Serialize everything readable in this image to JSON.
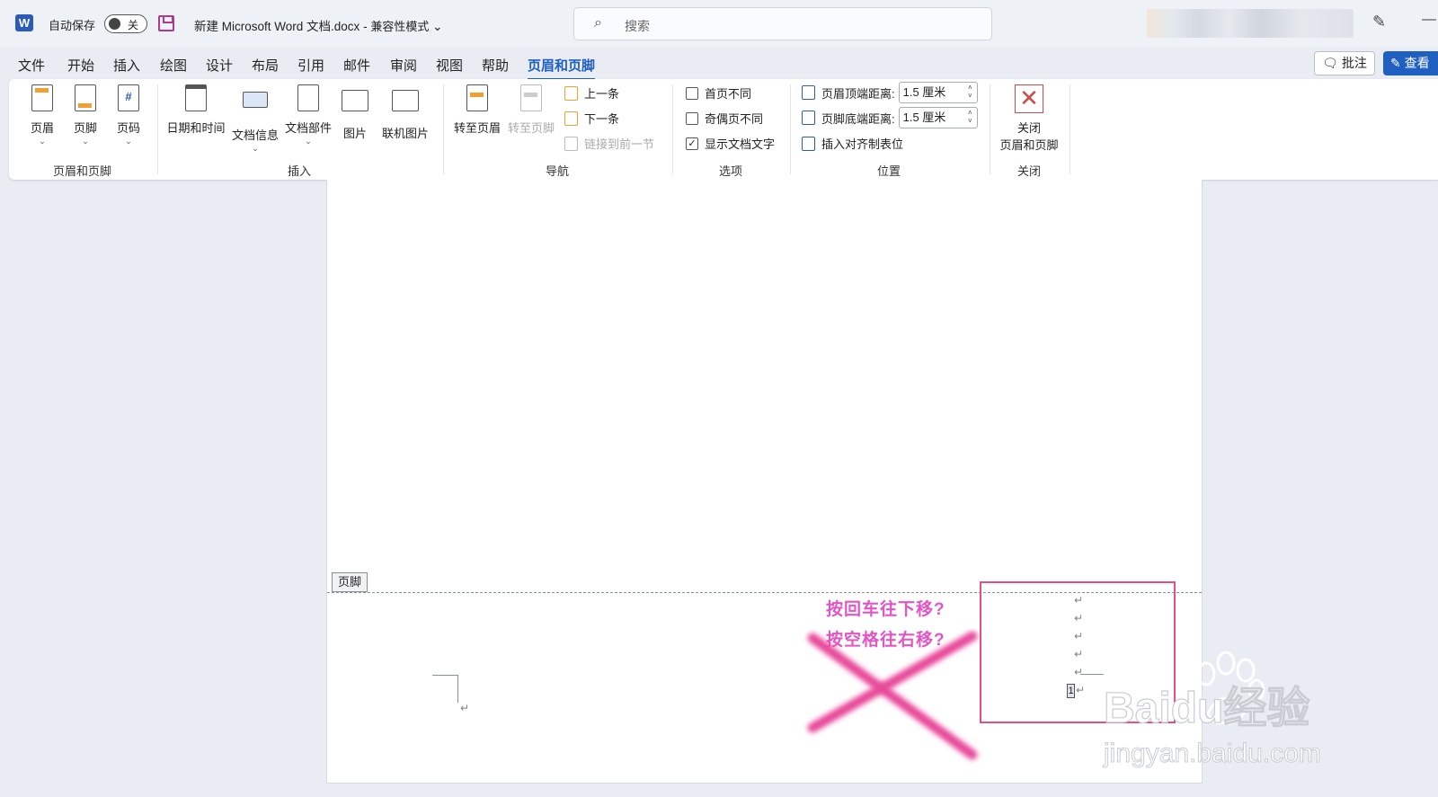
{
  "titlebar": {
    "app_icon": "W",
    "autosave_label": "自动保存",
    "autosave_state": "关",
    "doc_title": "新建 Microsoft Word 文档.docx",
    "separator": "-",
    "mode": "兼容性模式",
    "search_placeholder": "搜索"
  },
  "menu": {
    "tabs": [
      "文件",
      "开始",
      "插入",
      "绘图",
      "设计",
      "布局",
      "引用",
      "邮件",
      "审阅",
      "视图",
      "帮助",
      "页眉和页脚"
    ],
    "active_tab": "页眉和页脚",
    "comment_button": "批注",
    "view_button": "查看"
  },
  "ribbon": {
    "header_footer_group": {
      "label": "页眉和页脚",
      "buttons": [
        "页眉",
        "页脚",
        "页码"
      ]
    },
    "insert_group": {
      "label": "插入",
      "buttons": [
        "日期和时间",
        "文档信息",
        "文档部件",
        "图片",
        "联机图片"
      ]
    },
    "nav_group": {
      "label": "导航",
      "goto_header": "转至页眉",
      "goto_footer": "转至页脚",
      "previous": "上一条",
      "next": "下一条",
      "link_previous": "链接到前一节"
    },
    "options_group": {
      "label": "选项",
      "first_page_diff": "首页不同",
      "odd_even_diff": "奇偶页不同",
      "show_doc_text": "显示文档文字",
      "first_page_checked": false,
      "odd_even_checked": false,
      "show_doc_text_checked": true
    },
    "position_group": {
      "label": "位置",
      "header_top_label": "页眉顶端距离:",
      "header_top_value": "1.5 厘米",
      "footer_bottom_label": "页脚底端距离:",
      "footer_bottom_value": "1.5 厘米",
      "insert_align_tab": "插入对齐制表位"
    },
    "close_group": {
      "label": "关闭",
      "close_line1": "关闭",
      "close_line2": "页眉和页脚"
    }
  },
  "document": {
    "footer_tag": "页脚",
    "paragraph_mark": "↵",
    "page_number": "1",
    "annotation_line1": "按回车往下移?",
    "annotation_line2": "按空格往右移?"
  },
  "watermark": {
    "brand": "Baidu经验",
    "url": "jingyan.baidu.com"
  },
  "colors": {
    "accent": "#1f5fbf",
    "annotation": "#e455c4",
    "highlight_box": "#e2507f",
    "cross": "#e8489a"
  }
}
